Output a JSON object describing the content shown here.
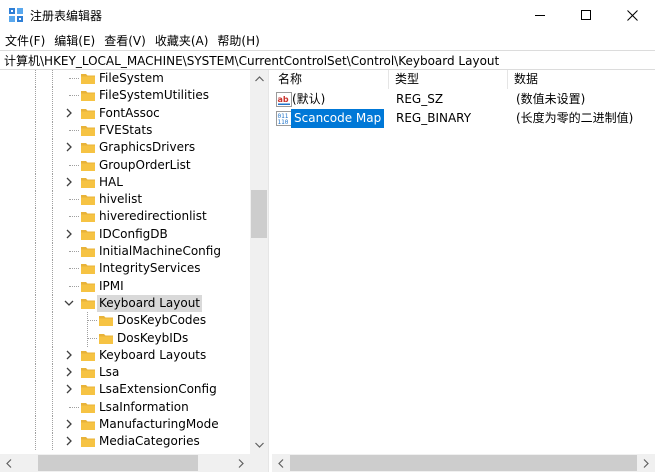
{
  "window": {
    "title": "注册表编辑器",
    "icon": "registry-editor-icon",
    "controls": {
      "minimize": "minimize-icon",
      "maximize": "maximize-icon",
      "close": "close-icon"
    }
  },
  "menu": [
    "文件(F)",
    "编辑(E)",
    "查看(V)",
    "收藏夹(A)",
    "帮助(H)"
  ],
  "address": "计算机\\HKEY_LOCAL_MACHINE\\SYSTEM\\CurrentControlSet\\Control\\Keyboard Layout",
  "tree": {
    "items": [
      {
        "label": "FileSystem",
        "expandable": false,
        "level": 1
      },
      {
        "label": "FileSystemUtilities",
        "expandable": false,
        "level": 1
      },
      {
        "label": "FontAssoc",
        "expandable": true,
        "level": 1
      },
      {
        "label": "FVEStats",
        "expandable": false,
        "level": 1
      },
      {
        "label": "GraphicsDrivers",
        "expandable": true,
        "level": 1
      },
      {
        "label": "GroupOrderList",
        "expandable": false,
        "level": 1
      },
      {
        "label": "HAL",
        "expandable": true,
        "level": 1
      },
      {
        "label": "hivelist",
        "expandable": false,
        "level": 1
      },
      {
        "label": "hiveredirectionlist",
        "expandable": false,
        "level": 1
      },
      {
        "label": "IDConfigDB",
        "expandable": true,
        "level": 1
      },
      {
        "label": "InitialMachineConfig",
        "expandable": false,
        "level": 1
      },
      {
        "label": "IntegrityServices",
        "expandable": false,
        "level": 1
      },
      {
        "label": "IPMI",
        "expandable": false,
        "level": 1
      },
      {
        "label": "Keyboard Layout",
        "expandable": true,
        "expanded": true,
        "selected": true,
        "level": 1
      },
      {
        "label": "DosKeybCodes",
        "expandable": false,
        "level": 2
      },
      {
        "label": "DosKeybIDs",
        "expandable": false,
        "level": 2
      },
      {
        "label": "Keyboard Layouts",
        "expandable": true,
        "level": 1
      },
      {
        "label": "Lsa",
        "expandable": true,
        "level": 1
      },
      {
        "label": "LsaExtensionConfig",
        "expandable": true,
        "level": 1
      },
      {
        "label": "LsaInformation",
        "expandable": false,
        "level": 1
      },
      {
        "label": "ManufacturingMode",
        "expandable": true,
        "level": 1
      },
      {
        "label": "MediaCategories",
        "expandable": true,
        "level": 1
      }
    ]
  },
  "values": {
    "columns": {
      "name": "名称",
      "type": "类型",
      "data": "数据"
    },
    "rows": [
      {
        "name": "(默认)",
        "type": "REG_SZ",
        "data": "(数值未设置)",
        "icon": "string-value-icon",
        "selected": false
      },
      {
        "name": "Scancode Map",
        "type": "REG_BINARY",
        "data": "(长度为零的二进制值)",
        "icon": "binary-value-icon",
        "selected": true
      }
    ]
  },
  "colors": {
    "selection_blue": "#0078d7",
    "tree_selection": "#d9d9d9",
    "folder_yellow": "#f6c343",
    "scrollbar_track": "#f0f0f0",
    "scrollbar_thumb": "#cdcdcd"
  }
}
